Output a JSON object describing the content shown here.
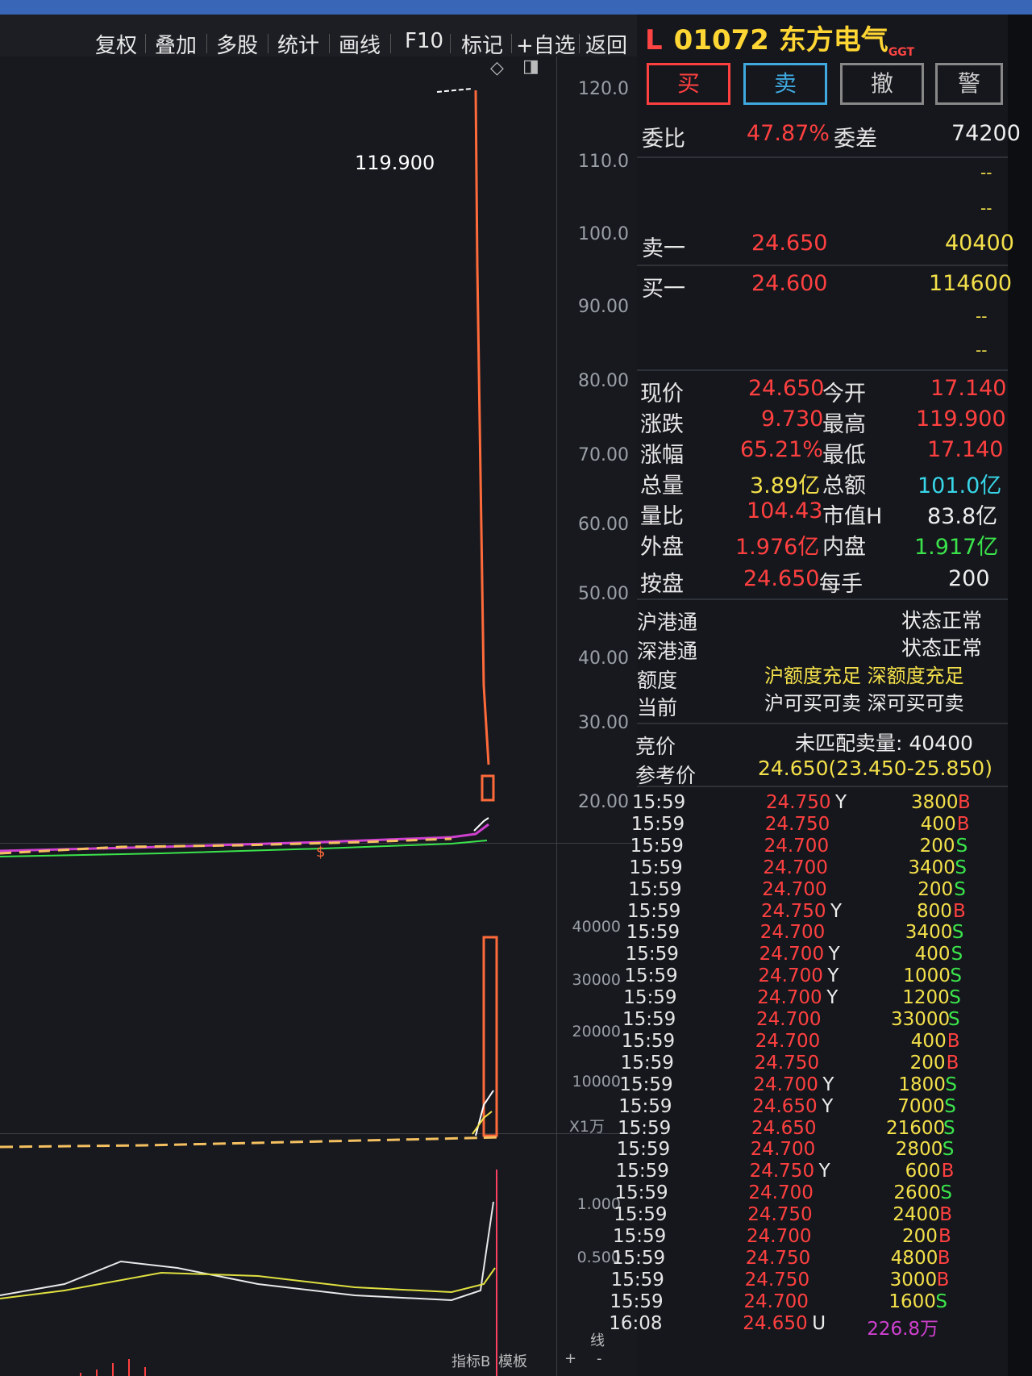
{
  "toolbar": {
    "items": [
      "复权",
      "叠加",
      "多股",
      "统计",
      "画线",
      "F10",
      "标记",
      "+自选",
      "返回"
    ]
  },
  "chart": {
    "price_callout": "119.900",
    "price_axis": [
      "120.0",
      "110.0",
      "100.0",
      "90.00",
      "80.00",
      "70.00",
      "60.00",
      "50.00",
      "40.00",
      "30.00",
      "20.00"
    ],
    "volume_axis": [
      "40000",
      "30000",
      "20000",
      "10000",
      "X1万"
    ],
    "indicator_axis": [
      "1.000",
      "0.500"
    ],
    "marker": "$",
    "bottom_tabs": [
      "指标B",
      "模板",
      "+",
      "-"
    ],
    "tab_label": "线"
  },
  "quote": {
    "market_flag": "L",
    "code": "01072",
    "name": "东方电气",
    "name_suffix": "GGT",
    "buttons": [
      "买",
      "卖",
      "撤",
      "警"
    ],
    "weibi_label": "委比",
    "weibi_value": "47.87%",
    "weicha_label": "委差",
    "weicha_value": "74200",
    "placeholder": "--",
    "sell1_label": "卖一",
    "sell1_price": "24.650",
    "sell1_vol": "40400",
    "buy1_label": "买一",
    "buy1_price": "24.600",
    "buy1_vol": "114600"
  },
  "stats": [
    {
      "l1": "现价",
      "v1": "24.650",
      "c1": "red",
      "l2": "今开",
      "v2": "17.140",
      "c2": "red"
    },
    {
      "l1": "涨跌",
      "v1": "9.730",
      "c1": "red",
      "l2": "最高",
      "v2": "119.900",
      "c2": "red"
    },
    {
      "l1": "涨幅",
      "v1": "65.21%",
      "c1": "red",
      "l2": "最低",
      "v2": "17.140",
      "c2": "red"
    },
    {
      "l1": "总量",
      "v1": "3.89亿",
      "c1": "yellow",
      "l2": "总额",
      "v2": "101.0亿",
      "c2": "cyan"
    },
    {
      "l1": "量比",
      "v1": "104.43",
      "c1": "red",
      "l2": "市值H",
      "v2": "83.8亿",
      "c2": "white"
    },
    {
      "l1": "外盘",
      "v1": "1.976亿",
      "c1": "red",
      "l2": "内盘",
      "v2": "1.917亿",
      "c2": "green"
    },
    {
      "l1": "按盘",
      "v1": "24.650",
      "c1": "red",
      "l2": "每手",
      "v2": "200",
      "c2": "white"
    }
  ],
  "connect": {
    "hk_sh_label": "沪港通",
    "hk_sh_status": "状态正常",
    "hk_sz_label": "深港通",
    "hk_sz_status": "状态正常",
    "quota_label": "额度",
    "quota_value": "沪额度充足 深额度充足",
    "current_label": "当前",
    "current_value": "沪可买可卖 深可买可卖"
  },
  "auction": {
    "label": "竞价",
    "unmatched": "未匹配卖量: 40400",
    "ref_label": "参考价",
    "ref_value": "24.650(23.450-25.850)"
  },
  "ticks": [
    {
      "time": "15:59",
      "price": "24.750",
      "flag": "Y",
      "vol": "3800",
      "side": "B"
    },
    {
      "time": "15:59",
      "price": "24.750",
      "flag": "",
      "vol": "400",
      "side": "B"
    },
    {
      "time": "15:59",
      "price": "24.700",
      "flag": "",
      "vol": "200",
      "side": "S"
    },
    {
      "time": "15:59",
      "price": "24.700",
      "flag": "",
      "vol": "3400",
      "side": "S"
    },
    {
      "time": "15:59",
      "price": "24.700",
      "flag": "",
      "vol": "200",
      "side": "S"
    },
    {
      "time": "15:59",
      "price": "24.750",
      "flag": "Y",
      "vol": "800",
      "side": "B"
    },
    {
      "time": "15:59",
      "price": "24.700",
      "flag": "",
      "vol": "3400",
      "side": "S"
    },
    {
      "time": "15:59",
      "price": "24.700",
      "flag": "Y",
      "vol": "400",
      "side": "S"
    },
    {
      "time": "15:59",
      "price": "24.700",
      "flag": "Y",
      "vol": "1000",
      "side": "S"
    },
    {
      "time": "15:59",
      "price": "24.700",
      "flag": "Y",
      "vol": "1200",
      "side": "S"
    },
    {
      "time": "15:59",
      "price": "24.700",
      "flag": "",
      "vol": "33000",
      "side": "S"
    },
    {
      "time": "15:59",
      "price": "24.700",
      "flag": "",
      "vol": "400",
      "side": "B"
    },
    {
      "time": "15:59",
      "price": "24.750",
      "flag": "",
      "vol": "200",
      "side": "B"
    },
    {
      "time": "15:59",
      "price": "24.700",
      "flag": "Y",
      "vol": "1800",
      "side": "S"
    },
    {
      "time": "15:59",
      "price": "24.650",
      "flag": "Y",
      "vol": "7000",
      "side": "S"
    },
    {
      "time": "15:59",
      "price": "24.650",
      "flag": "",
      "vol": "21600",
      "side": "S"
    },
    {
      "time": "15:59",
      "price": "24.700",
      "flag": "",
      "vol": "2800",
      "side": "S"
    },
    {
      "time": "15:59",
      "price": "24.750",
      "flag": "Y",
      "vol": "600",
      "side": "B"
    },
    {
      "time": "15:59",
      "price": "24.700",
      "flag": "",
      "vol": "2600",
      "side": "S"
    },
    {
      "time": "15:59",
      "price": "24.750",
      "flag": "",
      "vol": "2400",
      "side": "B"
    },
    {
      "time": "15:59",
      "price": "24.700",
      "flag": "",
      "vol": "200",
      "side": "B"
    },
    {
      "time": "15:59",
      "price": "24.750",
      "flag": "",
      "vol": "4800",
      "side": "B"
    },
    {
      "time": "15:59",
      "price": "24.750",
      "flag": "",
      "vol": "3000",
      "side": "B"
    },
    {
      "time": "15:59",
      "price": "24.700",
      "flag": "",
      "vol": "1600",
      "side": "S"
    },
    {
      "time": "16:08",
      "price": "24.650",
      "flag": "U",
      "vol": "226.8万",
      "side": ""
    }
  ],
  "colors": {
    "up": "#ff4040",
    "down": "#3be34b",
    "volume": "#f4e04a",
    "accent_line": "#ff7a3a",
    "background": "#15171c"
  }
}
